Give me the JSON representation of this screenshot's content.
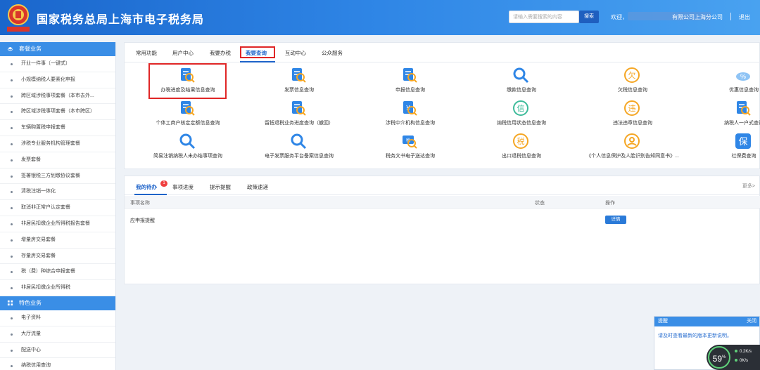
{
  "header": {
    "title": "国家税务总局上海市电子税务局",
    "logo_text": "中国税务",
    "search_placeholder": "请输入需要搜索的内容",
    "search_button": "搜索",
    "welcome": "欢迎，",
    "company": "有限公司上海分公司",
    "logout": "退出"
  },
  "sidebar": {
    "section1": "套餐业务",
    "section1_items": [
      "开业一件事（一键式）",
      "小规模纳税人要素化申报",
      "跨区域涉税事项套餐（本市去外...",
      "跨区域涉税事项套餐（本市跨区）",
      "车辆购置税申报套餐",
      "涉税专业服务机构管理套餐",
      "发票套餐",
      "签署银税三方划缴协议套餐",
      "清税注销一体化",
      "取消非正常户认定套餐",
      "非居民扣缴企业所得税报告套餐",
      "增量房交易套餐",
      "存量房交易套餐",
      "税（费）种综合申报套餐",
      "非居民扣缴企业所得税"
    ],
    "section2": "特色业务",
    "section2_items": [
      "电子资料",
      "大厅流量",
      "配送中心",
      "纳税信用查询"
    ]
  },
  "top_tabs": [
    "常用功能",
    "用户中心",
    "我要办税",
    "我要查询",
    "互动中心",
    "公众服务"
  ],
  "services": [
    {
      "label": "办税进度及结果信息查询",
      "icon": "progress-search-icon"
    },
    {
      "label": "发票信息查询",
      "icon": "invoice-search-icon"
    },
    {
      "label": "申报信息查询",
      "icon": "declaration-icon"
    },
    {
      "label": "缴款信息查询",
      "icon": "search-icon"
    },
    {
      "label": "欠税信息查询",
      "icon": "owed-tax-icon"
    },
    {
      "label": "优惠信息查询",
      "icon": "discount-icon"
    },
    {
      "label": "个体工商户核定定额信息查询",
      "icon": "quota-icon"
    },
    {
      "label": "留抵退税业务进度查询（撤回）",
      "icon": "refund-progress-icon"
    },
    {
      "label": "涉税中介机构信息查询",
      "icon": "agency-icon"
    },
    {
      "label": "纳税信用状态信息查询",
      "icon": "credit-icon"
    },
    {
      "label": "违法违章信息查询",
      "icon": "violation-icon"
    },
    {
      "label": "纳税人一户式查询",
      "icon": "taxpayer-icon"
    },
    {
      "label": "简易注销纳税人未办结事项查询",
      "icon": "search-icon"
    },
    {
      "label": "电子发票服务平台备案信息查询",
      "icon": "search-icon"
    },
    {
      "label": "税务文书电子送达查询",
      "icon": "document-icon"
    },
    {
      "label": "出口退税信息查询",
      "icon": "export-refund-icon"
    },
    {
      "label": "《个人信息保护及人脸识别告知同意书》...",
      "icon": "face-id-icon"
    },
    {
      "label": "社保费查询",
      "icon": "insurance-icon"
    }
  ],
  "mid_tabs": [
    "我的待办",
    "事项进度",
    "提示提醒",
    "政策速递"
  ],
  "badge": "1",
  "more": "更多>",
  "table": {
    "headers": [
      "事项名称",
      "状态",
      "操作"
    ],
    "rows": [
      {
        "name": "应申报提醒",
        "action": "详情"
      }
    ]
  },
  "popup": {
    "title": "提醒",
    "close": "关闭",
    "message": "请及时查看最新的版本更新说明。"
  },
  "network": {
    "percent": "59",
    "unit": "%",
    "up": "0.2K/s",
    "down": "0K/s"
  }
}
